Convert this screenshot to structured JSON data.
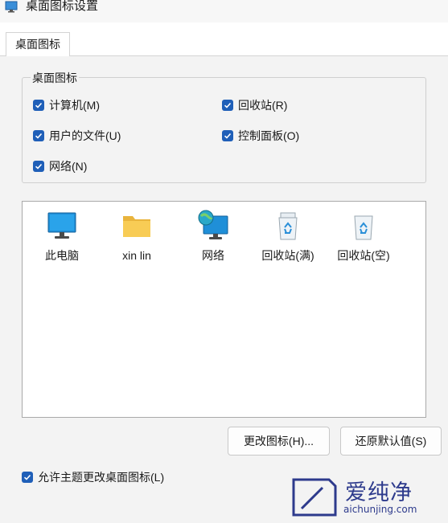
{
  "window": {
    "title": "桌面图标设置"
  },
  "tabs": [
    {
      "label": "桌面图标"
    }
  ],
  "group": {
    "title": "桌面图标",
    "checkboxes": [
      {
        "label": "计算机(M)",
        "checked": true
      },
      {
        "label": "回收站(R)",
        "checked": true
      },
      {
        "label": "用户的文件(U)",
        "checked": true
      },
      {
        "label": "控制面板(O)",
        "checked": true
      },
      {
        "label": "网络(N)",
        "checked": true
      }
    ]
  },
  "icons": [
    {
      "label": "此电脑",
      "icon": "monitor-icon"
    },
    {
      "label": "xin lin",
      "icon": "folder-icon"
    },
    {
      "label": "网络",
      "icon": "network-globe-icon"
    },
    {
      "label": "回收站(满)",
      "icon": "recycle-bin-full-icon"
    },
    {
      "label": "回收站(空)",
      "icon": "recycle-bin-empty-icon"
    }
  ],
  "buttons": {
    "change_icon": "更改图标(H)...",
    "restore_default": "还原默认值(S)"
  },
  "allow_themes": {
    "label": "允许主题更改桌面图标(L)",
    "checked": true
  },
  "watermark": {
    "name": "爱纯净",
    "url": "aichunjing.com"
  },
  "colors": {
    "checkbox": "#1f5fb8",
    "panel": "#f3f3f3",
    "watermark": "#2d3a8c"
  }
}
